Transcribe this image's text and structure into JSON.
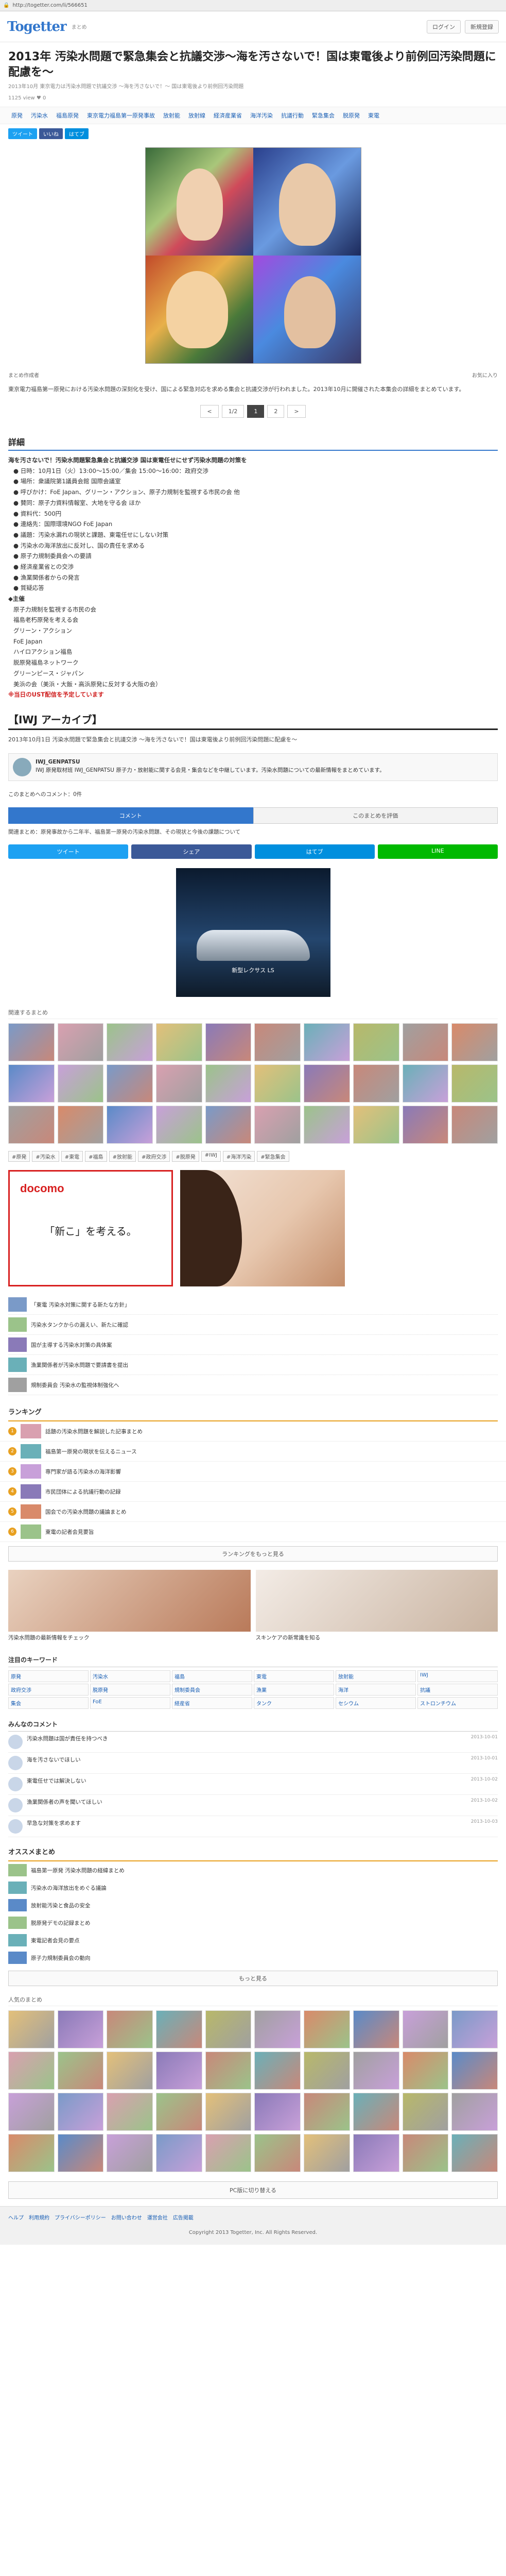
{
  "browser": {
    "url": "http://togetter.com/li/566651"
  },
  "header": {
    "logo": "Togetter",
    "logo_sub": "まとめ",
    "login_label": "ログイン",
    "signup_label": "新規登録"
  },
  "post": {
    "title": "2013年 汚染水問題で緊急集会と抗議交渉～海を汚さないで！国は東電後より前例回汚染問題に配慮を～",
    "meta": "2013年10月 東京電力は汚染水問題で抗議交渉 ～海を汚さないで！～ 国は東電後より前例回汚染問題",
    "views": "1125 view",
    "likes": "0"
  },
  "tagnav": [
    "原発",
    "汚染水",
    "福島原発",
    "東京電力福島第一原発事故",
    "放射能",
    "放射線",
    "経済産業省",
    "海洋汚染",
    "抗議行動",
    "緊急集会",
    "脱原発",
    "東電"
  ],
  "share": [
    {
      "label": "ツイート",
      "color": "#1da1f2"
    },
    {
      "label": "いいね",
      "color": "#3b5998"
    },
    {
      "label": "はてブ",
      "color": "#008fde"
    }
  ],
  "hero_caption": {
    "left": "まとめ作成者",
    "right": "お気に入り"
  },
  "intro": "東京電力福島第一原発における汚染水問題の深刻化を受け、国による緊急対応を求める集会と抗議交渉が行われました。2013年10月に開催された本集会の詳細をまとめています。",
  "pager": {
    "prev": "<",
    "first": "1/2",
    "current": "1",
    "next": "2",
    "last": ">"
  },
  "detail": {
    "heading": "詳細",
    "lead": "海を汚さないで！汚染水問題緊急集会と抗議交渉 国は東電任せにせず汚染水問題の対策を",
    "items": [
      "● 日時：10月1日（火）13:00～15:00／集会 15:00～16:00：政府交渉",
      "● 場所：衆議院第1議員会館 国際会議室",
      "● 呼びかけ：FoE Japan、グリーン・アクション、原子力規制を監視する市民の会 他",
      "● 賛同：原子力資料情報室、大地を守る会 ほか",
      "● 資料代：500円",
      "● 連絡先：国際環境NGO FoE Japan",
      "● 議題：汚染水漏れの現状と課題、東電任せにしない対策",
      "● 汚染水の海洋放出に反対し、国の責任を求める",
      "● 原子力規制委員会への要請",
      "● 経済産業省との交渉",
      "● 漁業関係者からの発言",
      "● 質疑応答"
    ],
    "sub_lead": "◆主催",
    "organizers": [
      "原子力規制を監視する市民の会",
      "福島老朽原発を考える会",
      "グリーン・アクション",
      "FoE Japan",
      "ハイロアクション福島",
      "脱原発福島ネットワーク",
      "グリーンピース・ジャパン",
      "美浜の会（美浜・大飯・高浜原発に反対する大阪の会）"
    ],
    "red_note": "※当日のUST配信を予定しています"
  },
  "archive": {
    "heading": "【IWJ アーカイブ】",
    "text": "2013年10月1日 汚染水問題で緊急集会と抗議交渉 ～海を汚さないで！国は東電後より前例回汚染問題に配慮を～",
    "author_name": "IWJ_GENPATSU",
    "author_text": "IWJ 原発取材班 IWJ_GENPATSU 原子力・放射能に関する会見・集会などを中継しています。汚染水問題についての最新情報をまとめています。"
  },
  "comment_bar": {
    "text": "このまとめへのコメント：0件"
  },
  "tabs": [
    {
      "label": "コメント",
      "active": true
    },
    {
      "label": "このまとめを評価",
      "active": false
    }
  ],
  "related_text": "関連まとめ：原発事故から二年半、福島第一原発の汚染水問題、その現状と今後の課題について",
  "social_bar": [
    {
      "label": "ツイート",
      "color": "#1da1f2"
    },
    {
      "label": "シェア",
      "color": "#3b5998"
    },
    {
      "label": "はてブ",
      "color": "#008fde"
    },
    {
      "label": "LINE",
      "color": "#00b900"
    }
  ],
  "ad_car": {
    "text": "新型レクサス LS"
  },
  "grid_headers": {
    "related": "関連するまとめ",
    "popular": "人気のまとめ"
  },
  "tagcloud": [
    "#原発",
    "#汚染水",
    "#東電",
    "#福島",
    "#放射能",
    "#政府交渉",
    "#脱原発",
    "#IWJ",
    "#海洋汚染",
    "#緊急集会"
  ],
  "docomo": {
    "brand": "docomo",
    "copy": "「新こ」を考える。"
  },
  "news": [
    "「東電 汚染水対策に関する新たな方針」",
    "汚染水タンクからの漏えい、新たに確認",
    "国が主導する汚染水対策の具体案",
    "漁業関係者が汚染水問題で要請書を提出",
    "規制委員会 汚染水の監視体制強化へ"
  ],
  "ranking": {
    "heading": "ランキング",
    "items": [
      "話題の汚染水問題を解説した記事まとめ",
      "福島第一原発の現状を伝えるニュース",
      "専門家が語る汚染水の海洋影響",
      "市民団体による抗議行動の記録",
      "国会での汚染水問題の議論まとめ",
      "東電の記者会見要旨"
    ],
    "more_label": "ランキングをもっと見る"
  },
  "pr": [
    {
      "caption": "汚染水問題の最新情報をチェック"
    },
    {
      "caption": "スキンケアの新常識を知る"
    }
  ],
  "keywords": {
    "heading": "注目のキーワード",
    "items": [
      "原発",
      "汚染水",
      "福島",
      "東電",
      "放射能",
      "IWJ",
      "政府交渉",
      "脱原発",
      "規制委員会",
      "漁業",
      "海洋",
      "抗議",
      "集会",
      "FoE",
      "経産省",
      "タンク",
      "セシウム",
      "ストロンチウム"
    ]
  },
  "comments": {
    "heading": "みんなのコメント",
    "items": [
      {
        "text": "汚染水問題は国が責任を持つべき",
        "ts": "2013-10-01"
      },
      {
        "text": "海を汚さないでほしい",
        "ts": "2013-10-01"
      },
      {
        "text": "東電任せでは解決しない",
        "ts": "2013-10-02"
      },
      {
        "text": "漁業関係者の声を聞いてほしい",
        "ts": "2013-10-02"
      },
      {
        "text": "早急な対策を求めます",
        "ts": "2013-10-03"
      }
    ]
  },
  "recommend": {
    "heading": "オススメまとめ",
    "items": [
      "福島第一原発 汚染水問題の経緯まとめ",
      "汚染水の海洋放出をめぐる議論",
      "放射能汚染と食品の安全",
      "脱原発デモの記録まとめ",
      "東電記者会見の要点",
      "原子力規制委員会の動向"
    ],
    "more_label": "もっと見る"
  },
  "pc_label": "PC版に切り替える",
  "footer": {
    "links": [
      "ヘルプ",
      "利用規約",
      "プライバシーポリシー",
      "お問い合わせ",
      "運営会社",
      "広告掲載"
    ],
    "copyright": "Copyright 2013 Togetter, Inc. All Rights Reserved."
  }
}
